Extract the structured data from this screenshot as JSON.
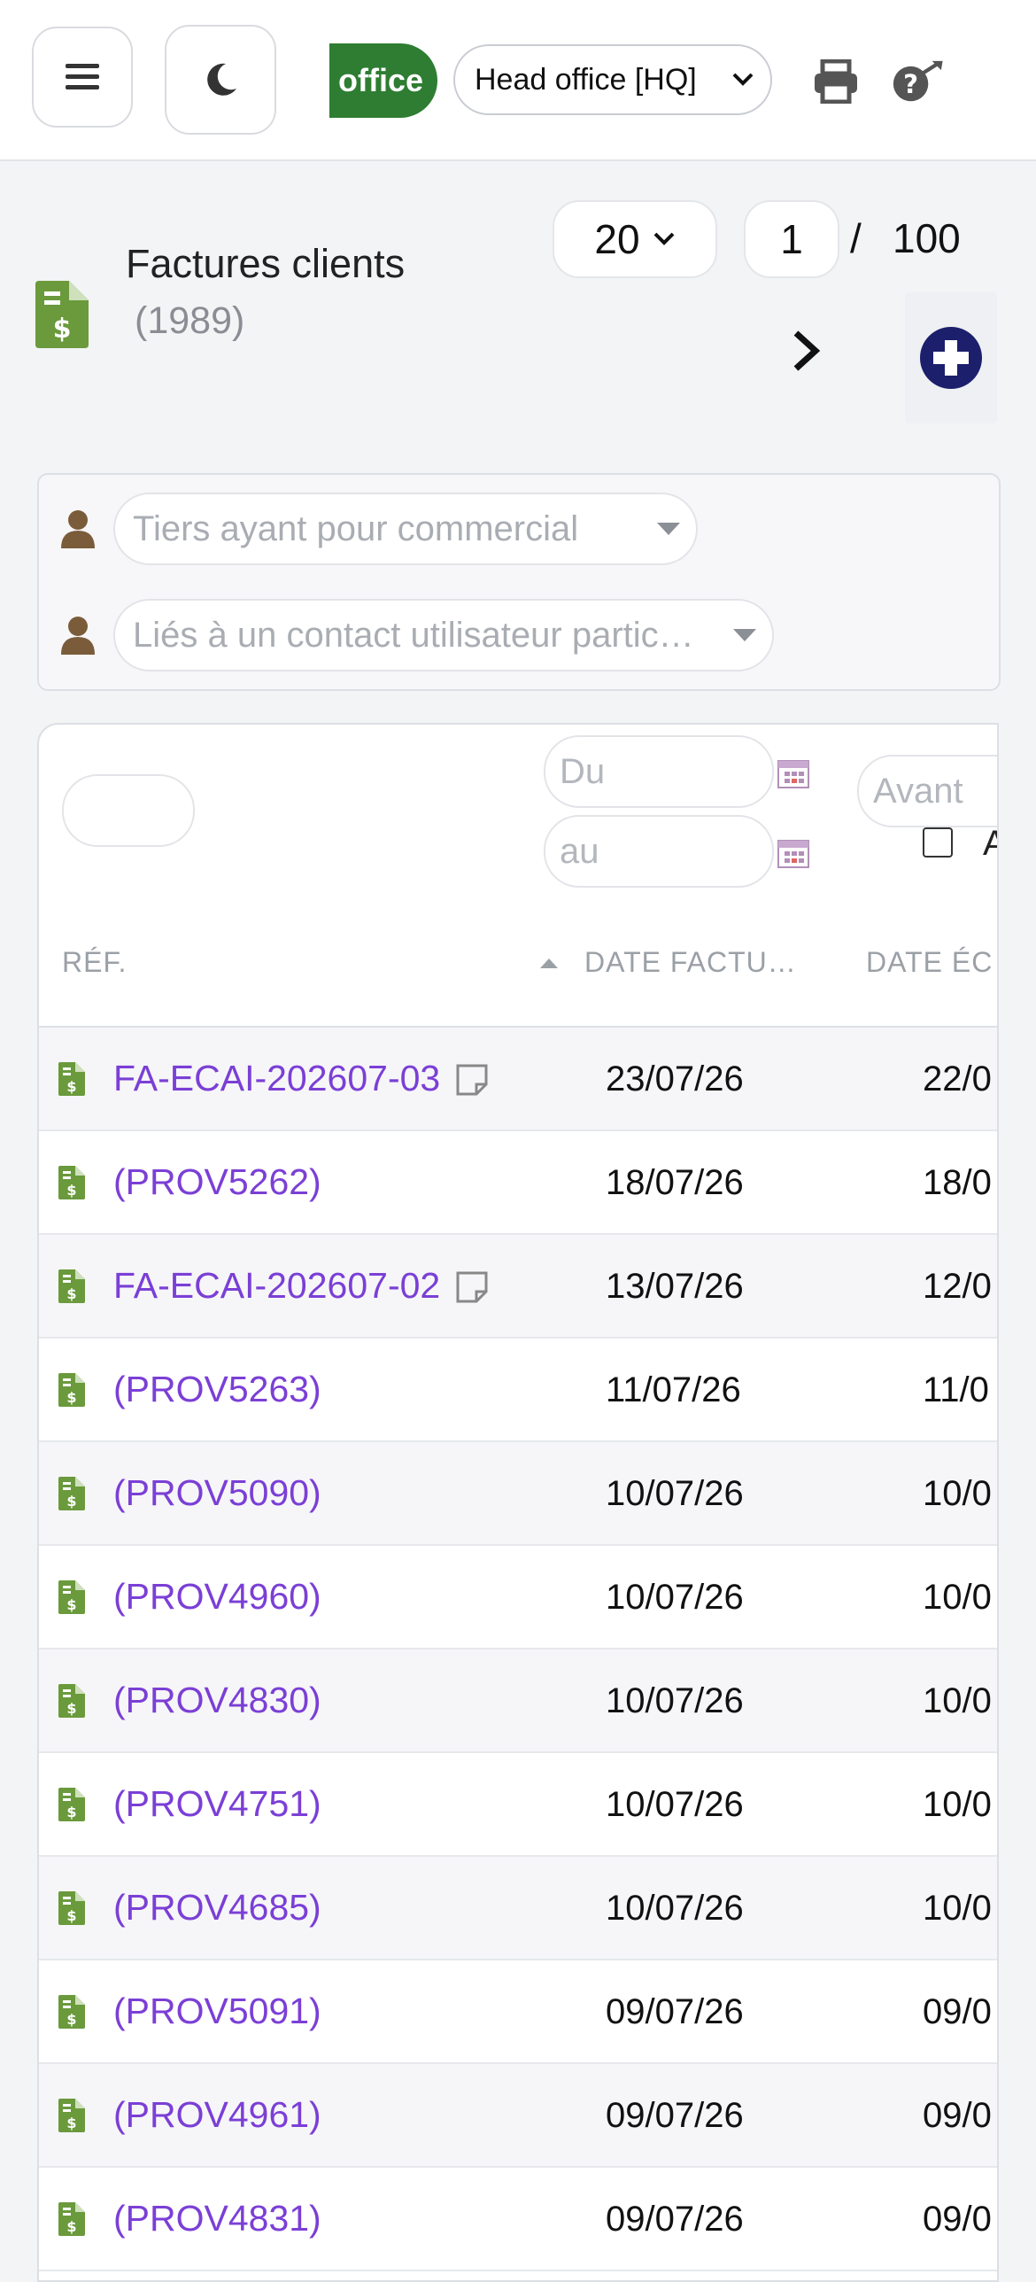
{
  "topbar": {
    "entity_badge": "office",
    "entity_select": "Head office [HQ]",
    "icons": [
      "menu-icon",
      "moon-icon",
      "print-icon",
      "help-icon"
    ]
  },
  "header": {
    "title": "Factures clients",
    "count": "(1989)",
    "limit": "20",
    "page": "1",
    "page_sep": "/",
    "page_total": "100"
  },
  "filters": {
    "sales_rep_placeholder": "Tiers ayant pour commercial",
    "contact_placeholder": "Liés à un contact utilisateur partic…"
  },
  "table": {
    "filter_date_from": "Du",
    "filter_date_to": "au",
    "filter_before": "Avant",
    "checkbox_label": "A",
    "headers": {
      "ref": "RÉF.",
      "date_invoice": "DATE FACTU…",
      "date_due": "DATE ÉC"
    },
    "rows": [
      {
        "ref": "FA-ECAI-202607-03",
        "note": true,
        "date_invoice": "23/07/26",
        "date_due": "22/0"
      },
      {
        "ref": "(PROV5262)",
        "note": false,
        "date_invoice": "18/07/26",
        "date_due": "18/0"
      },
      {
        "ref": "FA-ECAI-202607-02",
        "note": true,
        "date_invoice": "13/07/26",
        "date_due": "12/0"
      },
      {
        "ref": "(PROV5263)",
        "note": false,
        "date_invoice": "11/07/26",
        "date_due": "11/0"
      },
      {
        "ref": "(PROV5090)",
        "note": false,
        "date_invoice": "10/07/26",
        "date_due": "10/0"
      },
      {
        "ref": "(PROV4960)",
        "note": false,
        "date_invoice": "10/07/26",
        "date_due": "10/0"
      },
      {
        "ref": "(PROV4830)",
        "note": false,
        "date_invoice": "10/07/26",
        "date_due": "10/0"
      },
      {
        "ref": "(PROV4751)",
        "note": false,
        "date_invoice": "10/07/26",
        "date_due": "10/0"
      },
      {
        "ref": "(PROV4685)",
        "note": false,
        "date_invoice": "10/07/26",
        "date_due": "10/0"
      },
      {
        "ref": "(PROV5091)",
        "note": false,
        "date_invoice": "09/07/26",
        "date_due": "09/0"
      },
      {
        "ref": "(PROV4961)",
        "note": false,
        "date_invoice": "09/07/26",
        "date_due": "09/0"
      },
      {
        "ref": "(PROV4831)",
        "note": false,
        "date_invoice": "09/07/26",
        "date_due": "09/0"
      }
    ]
  },
  "colors": {
    "accent_green": "#2e7d32",
    "invoice_icon_green": "#6a9a3c",
    "link_purple": "#7b3fd6",
    "new_button_navy": "#1c1f6b"
  }
}
